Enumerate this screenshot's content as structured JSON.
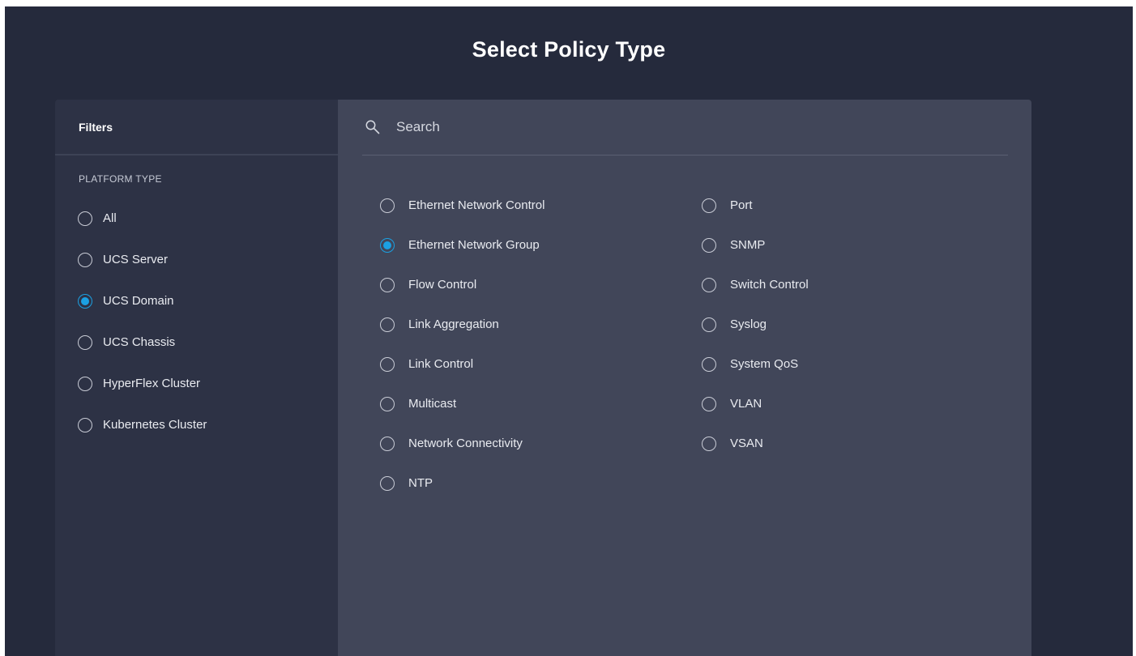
{
  "page": {
    "title": "Select Policy Type"
  },
  "filters": {
    "header": "Filters",
    "section_label": "PLATFORM TYPE",
    "options": [
      {
        "label": "All",
        "selected": false
      },
      {
        "label": "UCS Server",
        "selected": false
      },
      {
        "label": "UCS Domain",
        "selected": true
      },
      {
        "label": "UCS Chassis",
        "selected": false
      },
      {
        "label": "HyperFlex Cluster",
        "selected": false
      },
      {
        "label": "Kubernetes Cluster",
        "selected": false
      }
    ]
  },
  "search": {
    "placeholder": "Search",
    "value": "",
    "icon": "search-icon"
  },
  "policies": {
    "left": [
      {
        "label": "Ethernet Network Control",
        "selected": false
      },
      {
        "label": "Ethernet Network Group",
        "selected": true
      },
      {
        "label": "Flow Control",
        "selected": false
      },
      {
        "label": "Link Aggregation",
        "selected": false
      },
      {
        "label": "Link Control",
        "selected": false
      },
      {
        "label": "Multicast",
        "selected": false
      },
      {
        "label": "Network Connectivity",
        "selected": false
      },
      {
        "label": "NTP",
        "selected": false
      }
    ],
    "right": [
      {
        "label": "Port",
        "selected": false
      },
      {
        "label": "SNMP",
        "selected": false
      },
      {
        "label": "Switch Control",
        "selected": false
      },
      {
        "label": "Syslog",
        "selected": false
      },
      {
        "label": "System QoS",
        "selected": false
      },
      {
        "label": "VLAN",
        "selected": false
      },
      {
        "label": "VSAN",
        "selected": false
      }
    ]
  },
  "colors": {
    "background": "#252a3c",
    "filters_panel": "#2d3245",
    "content_panel": "#414659",
    "accent": "#1ba0e2"
  }
}
